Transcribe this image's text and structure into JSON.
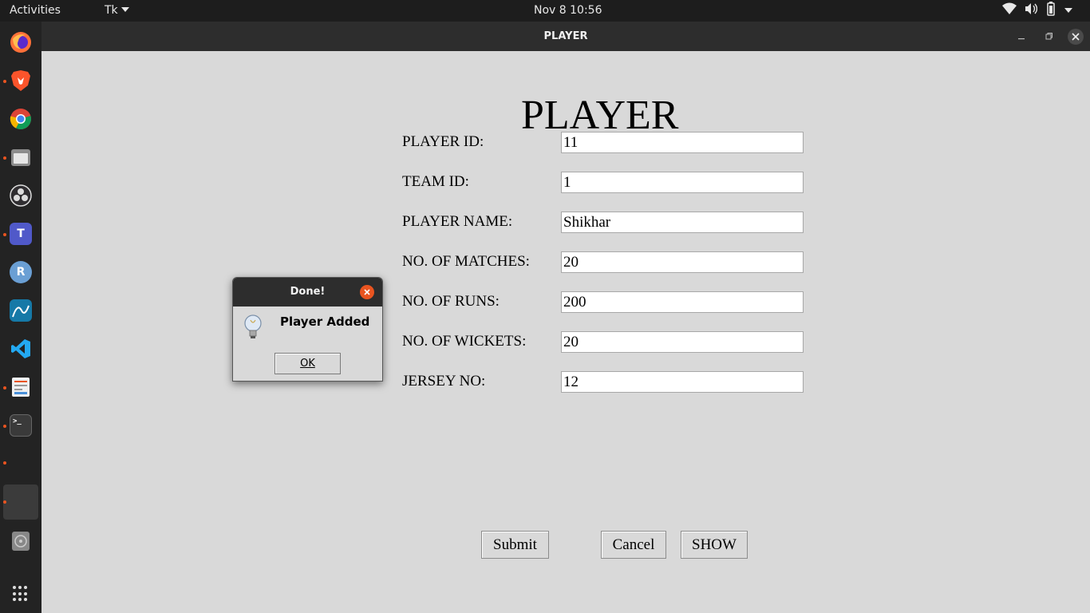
{
  "topbar": {
    "activities": "Activities",
    "app_menu": "Tk",
    "clock": "Nov 8  10:56"
  },
  "dock": {
    "apps": [
      "firefox-icon",
      "brave-icon",
      "chrome-icon",
      "files-icon",
      "obs-icon",
      "teams-icon",
      "r-icon",
      "wireshark-icon",
      "vscode-icon",
      "text-editor-icon",
      "terminal-icon",
      "active-window-icon",
      "disc-icon",
      "show-apps-icon"
    ],
    "r_letter": "R",
    "teams_letter": "T",
    "terminal_prompt": ">_"
  },
  "window": {
    "title": "PLAYER",
    "heading": "PLAYER"
  },
  "form": {
    "fields": [
      {
        "label": "PLAYER ID:",
        "value": "11"
      },
      {
        "label": "TEAM ID:",
        "value": "1"
      },
      {
        "label": "PLAYER NAME:",
        "value": "Shikhar"
      },
      {
        "label": "NO. OF MATCHES:",
        "value": "20"
      },
      {
        "label": "NO. OF RUNS:",
        "value": "200"
      },
      {
        "label": "NO. OF WICKETS:",
        "value": "20"
      },
      {
        "label": "JERSEY NO:",
        "value": "12"
      }
    ],
    "submit_label": "Submit",
    "cancel_label": "Cancel",
    "show_label": "SHOW"
  },
  "dialog": {
    "title": "Done!",
    "message": "Player Added",
    "ok_label": "OK"
  },
  "colors": {
    "accent": "#e95420",
    "window_bg": "#d9d9d9",
    "titlebar": "#2d2d2d"
  }
}
